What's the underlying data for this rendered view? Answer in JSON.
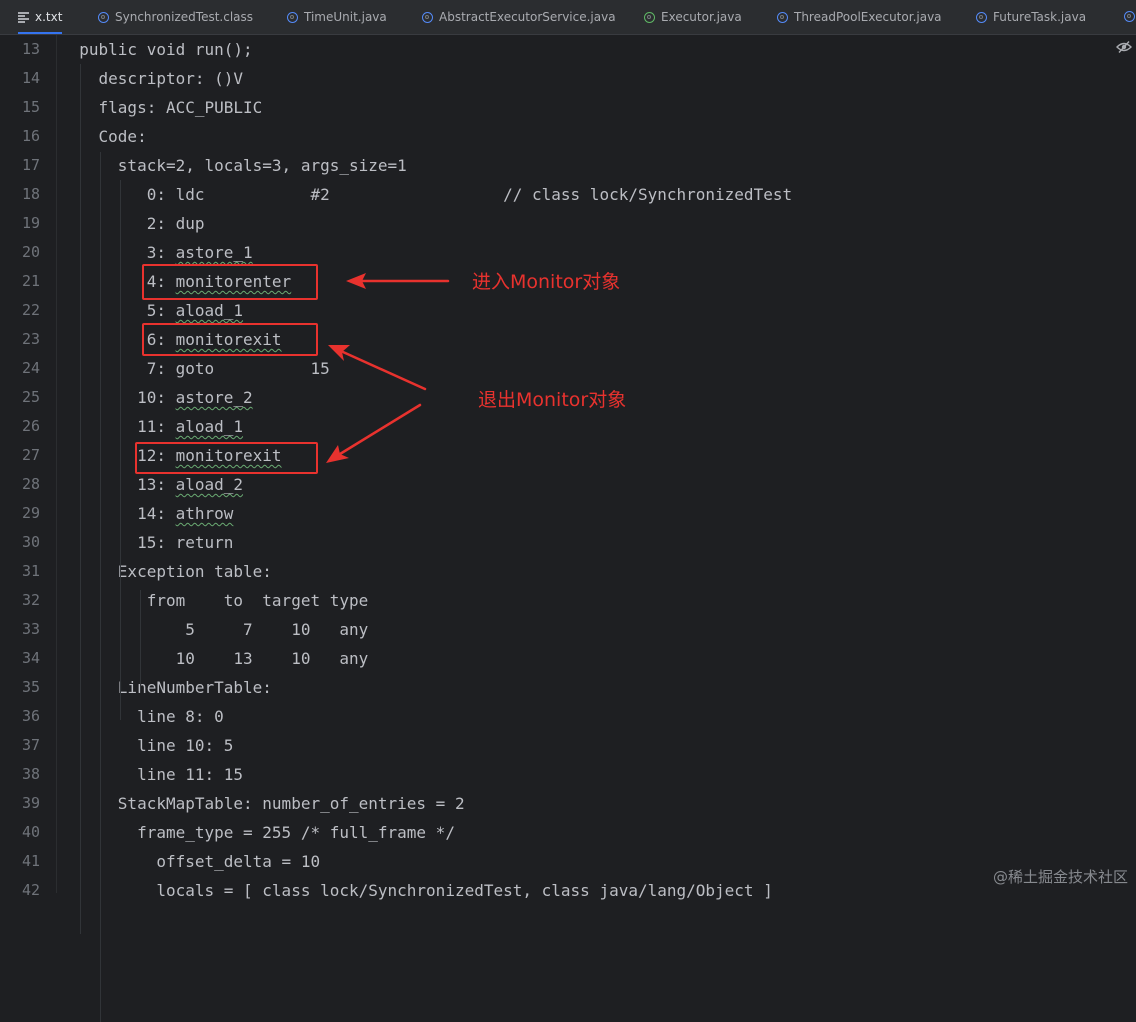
{
  "tabs": [
    {
      "label": "x.txt",
      "icon": "text-file-icon",
      "active": true
    },
    {
      "label": "SynchronizedTest.class",
      "icon": "class-icon"
    },
    {
      "label": "TimeUnit.java",
      "icon": "enum-icon"
    },
    {
      "label": "AbstractExecutorService.java",
      "icon": "class-icon"
    },
    {
      "label": "Executor.java",
      "icon": "interface-icon"
    },
    {
      "label": "ThreadPoolExecutor.java",
      "icon": "class-icon"
    },
    {
      "label": "FutureTask.java",
      "icon": "class-icon"
    }
  ],
  "lines": [
    {
      "num": "13",
      "text": "public void run();"
    },
    {
      "num": "14",
      "text": "  descriptor: ()V"
    },
    {
      "num": "15",
      "text": "  flags: ACC_PUBLIC"
    },
    {
      "num": "16",
      "text": "  Code:"
    },
    {
      "num": "17",
      "text": "    stack=2, locals=3, args_size=1"
    },
    {
      "num": "18",
      "text": "       0: ldc           #2                  // class lock/SynchronizedTest"
    },
    {
      "num": "19",
      "text": "       2: dup"
    },
    {
      "num": "20",
      "text": "       3: astore_1"
    },
    {
      "num": "21",
      "text": "       4: monitorenter"
    },
    {
      "num": "22",
      "text": "       5: aload_1"
    },
    {
      "num": "23",
      "text": "       6: monitorexit"
    },
    {
      "num": "24",
      "text": "       7: goto          15"
    },
    {
      "num": "25",
      "text": "      10: astore_2"
    },
    {
      "num": "26",
      "text": "      11: aload_1"
    },
    {
      "num": "27",
      "text": "      12: monitorexit"
    },
    {
      "num": "28",
      "text": "      13: aload_2"
    },
    {
      "num": "29",
      "text": "      14: athrow"
    },
    {
      "num": "30",
      "text": "      15: return"
    },
    {
      "num": "31",
      "text": "    Exception table:"
    },
    {
      "num": "32",
      "text": "       from    to  target type"
    },
    {
      "num": "33",
      "text": "           5     7    10   any"
    },
    {
      "num": "34",
      "text": "          10    13    10   any"
    },
    {
      "num": "35",
      "text": "    LineNumberTable:"
    },
    {
      "num": "36",
      "text": "      line 8: 0"
    },
    {
      "num": "37",
      "text": "      line 10: 5"
    },
    {
      "num": "38",
      "text": "      line 11: 15"
    },
    {
      "num": "39",
      "text": "    StackMapTable: number_of_entries = 2"
    },
    {
      "num": "40",
      "text": "      frame_type = 255 /* full_frame */"
    },
    {
      "num": "41",
      "text": "        offset_delta = 10"
    },
    {
      "num": "42",
      "text": "        locals = [ class lock/SynchronizedTest, class java/lang/Object ]"
    }
  ],
  "annotations": {
    "enter": "进入Monitor对象",
    "exit": "退出Monitor对象"
  },
  "annotation_color": "#e8322e",
  "watermark": "@稀土掘金技术社区"
}
